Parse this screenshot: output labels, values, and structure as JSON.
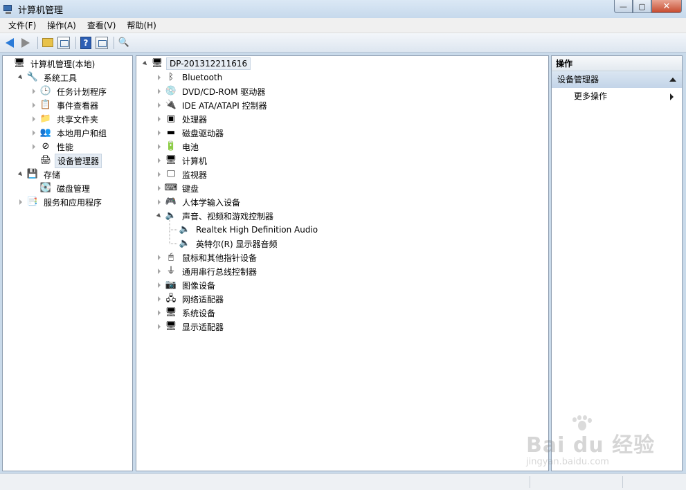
{
  "window": {
    "title": "计算机管理"
  },
  "menu": {
    "items": [
      "文件(F)",
      "操作(A)",
      "查看(V)",
      "帮助(H)"
    ]
  },
  "left_tree": [
    {
      "label": "计算机管理(本地)",
      "indent": 0,
      "expander": "none",
      "icon": "computer-management-icon",
      "glyph": "🖥"
    },
    {
      "label": "系统工具",
      "indent": 1,
      "expander": "open",
      "icon": "system-tools-icon",
      "glyph": "🔧"
    },
    {
      "label": "任务计划程序",
      "indent": 2,
      "expander": "closed",
      "icon": "clock-icon",
      "glyph": "🕒"
    },
    {
      "label": "事件查看器",
      "indent": 2,
      "expander": "closed",
      "icon": "event-viewer-icon",
      "glyph": "📋"
    },
    {
      "label": "共享文件夹",
      "indent": 2,
      "expander": "closed",
      "icon": "shared-folder-icon",
      "glyph": "📁"
    },
    {
      "label": "本地用户和组",
      "indent": 2,
      "expander": "closed",
      "icon": "users-icon",
      "glyph": "👥"
    },
    {
      "label": "性能",
      "indent": 2,
      "expander": "closed",
      "icon": "performance-icon",
      "glyph": "⊘"
    },
    {
      "label": "设备管理器",
      "indent": 2,
      "expander": "none",
      "icon": "device-manager-icon",
      "glyph": "🖨",
      "selected": true
    },
    {
      "label": "存储",
      "indent": 1,
      "expander": "open",
      "icon": "storage-icon",
      "glyph": "💾"
    },
    {
      "label": "磁盘管理",
      "indent": 2,
      "expander": "none",
      "icon": "disk-management-icon",
      "glyph": "💽"
    },
    {
      "label": "服务和应用程序",
      "indent": 1,
      "expander": "closed",
      "icon": "services-icon",
      "glyph": "📑"
    }
  ],
  "device_tree": {
    "root": "DP-201312211616",
    "items": [
      {
        "label": "Bluetooth",
        "indent": 1,
        "expander": "closed",
        "icon": "bluetooth-icon",
        "glyph": "ᛒ"
      },
      {
        "label": "DVD/CD-ROM 驱动器",
        "indent": 1,
        "expander": "closed",
        "icon": "dvd-drive-icon",
        "glyph": "💿"
      },
      {
        "label": "IDE ATA/ATAPI 控制器",
        "indent": 1,
        "expander": "closed",
        "icon": "ide-controller-icon",
        "glyph": "🔌"
      },
      {
        "label": "处理器",
        "indent": 1,
        "expander": "closed",
        "icon": "processor-icon",
        "glyph": "▣"
      },
      {
        "label": "磁盘驱动器",
        "indent": 1,
        "expander": "closed",
        "icon": "disk-drive-icon",
        "glyph": "▬"
      },
      {
        "label": "电池",
        "indent": 1,
        "expander": "closed",
        "icon": "battery-icon",
        "glyph": "🔋"
      },
      {
        "label": "计算机",
        "indent": 1,
        "expander": "closed",
        "icon": "computer-icon",
        "glyph": "🖥"
      },
      {
        "label": "监视器",
        "indent": 1,
        "expander": "closed",
        "icon": "monitor-icon",
        "glyph": "🖵"
      },
      {
        "label": "键盘",
        "indent": 1,
        "expander": "closed",
        "icon": "keyboard-icon",
        "glyph": "⌨"
      },
      {
        "label": "人体学输入设备",
        "indent": 1,
        "expander": "closed",
        "icon": "hid-icon",
        "glyph": "🎮"
      },
      {
        "label": "声音、视频和游戏控制器",
        "indent": 1,
        "expander": "open",
        "icon": "speaker-icon",
        "glyph": "🔈"
      },
      {
        "label": "Realtek High Definition Audio",
        "indent": 2,
        "expander": "none",
        "icon": "speaker-icon",
        "glyph": "🔈"
      },
      {
        "label": "英特尔(R) 显示器音频",
        "indent": 2,
        "expander": "none",
        "icon": "speaker-icon",
        "glyph": "🔈"
      },
      {
        "label": "鼠标和其他指针设备",
        "indent": 1,
        "expander": "closed",
        "icon": "mouse-icon",
        "glyph": "🖱"
      },
      {
        "label": "通用串行总线控制器",
        "indent": 1,
        "expander": "closed",
        "icon": "usb-icon",
        "glyph": "⏚"
      },
      {
        "label": "图像设备",
        "indent": 1,
        "expander": "closed",
        "icon": "camera-icon",
        "glyph": "📷"
      },
      {
        "label": "网络适配器",
        "indent": 1,
        "expander": "closed",
        "icon": "network-adapter-icon",
        "glyph": "🖧"
      },
      {
        "label": "系统设备",
        "indent": 1,
        "expander": "closed",
        "icon": "system-device-icon",
        "glyph": "🖥"
      },
      {
        "label": "显示适配器",
        "indent": 1,
        "expander": "closed",
        "icon": "display-adapter-icon",
        "glyph": "🖥"
      }
    ]
  },
  "actions": {
    "header": "操作",
    "section": "设备管理器",
    "more": "更多操作"
  },
  "watermark": {
    "main": "Bai du 经验",
    "sub": "jingyan.baidu.com"
  },
  "colors": {
    "selection": "#e4ebf3",
    "action_section": "#c3d4e8",
    "window_frame": "#c9daea"
  }
}
